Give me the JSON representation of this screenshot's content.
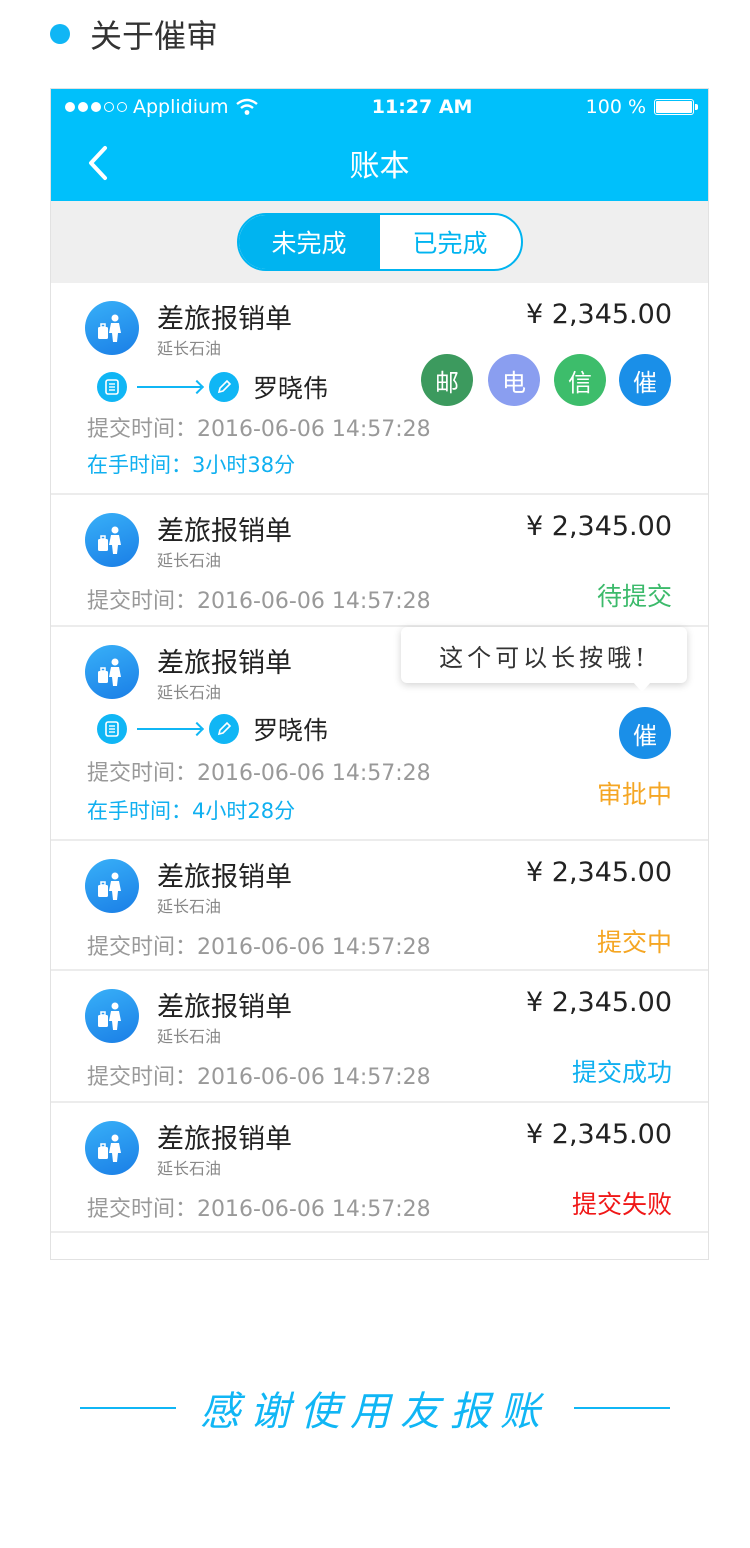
{
  "section": {
    "title": "关于催审"
  },
  "statusbar": {
    "carrier": "Applidium",
    "time": "11:27 AM",
    "battery": "100 %"
  },
  "nav": {
    "title": "账本"
  },
  "segment": {
    "active": "未完成",
    "inactive": "已完成"
  },
  "items": [
    {
      "title": "差旅报销单",
      "company": "延长石油",
      "amount": "¥ 2,345.00",
      "approver": "罗晓伟",
      "time": "提交时间：2016-06-06 14:57:28",
      "hold": "在手时间：3小时38分",
      "actions": [
        {
          "label": "邮",
          "color": "#3c9a5e"
        },
        {
          "label": "电",
          "color": "#8a9ef0"
        },
        {
          "label": "信",
          "color": "#3dbd6b"
        },
        {
          "label": "催",
          "color": "#1a8fe8"
        }
      ]
    },
    {
      "title": "差旅报销单",
      "company": "延长石油",
      "amount": "¥ 2,345.00",
      "time": "提交时间：2016-06-06 14:57:28",
      "status": "待提交",
      "status_color": "#3cba6b"
    },
    {
      "title": "差旅报销单",
      "company": "延长石油",
      "approver": "罗晓伟",
      "time": "提交时间：2016-06-06 14:57:28",
      "hold": "在手时间：4小时28分",
      "tooltip": "这个可以长按哦!",
      "action": {
        "label": "催",
        "color": "#1a8fe8"
      },
      "status": "审批中",
      "status_color": "#f5a623"
    },
    {
      "title": "差旅报销单",
      "company": "延长石油",
      "amount": "¥ 2,345.00",
      "time": "提交时间：2016-06-06 14:57:28",
      "status": "提交中",
      "status_color": "#f5a623"
    },
    {
      "title": "差旅报销单",
      "company": "延长石油",
      "amount": "¥ 2,345.00",
      "time": "提交时间：2016-06-06 14:57:28",
      "status": "提交成功",
      "status_color": "#10b0f0"
    },
    {
      "title": "差旅报销单",
      "company": "延长石油",
      "amount": "¥ 2,345.00",
      "time": "提交时间：2016-06-06 14:57:28",
      "status": "提交失败",
      "status_color": "#f01818"
    }
  ],
  "footer": {
    "text": "感谢使用友报账"
  }
}
